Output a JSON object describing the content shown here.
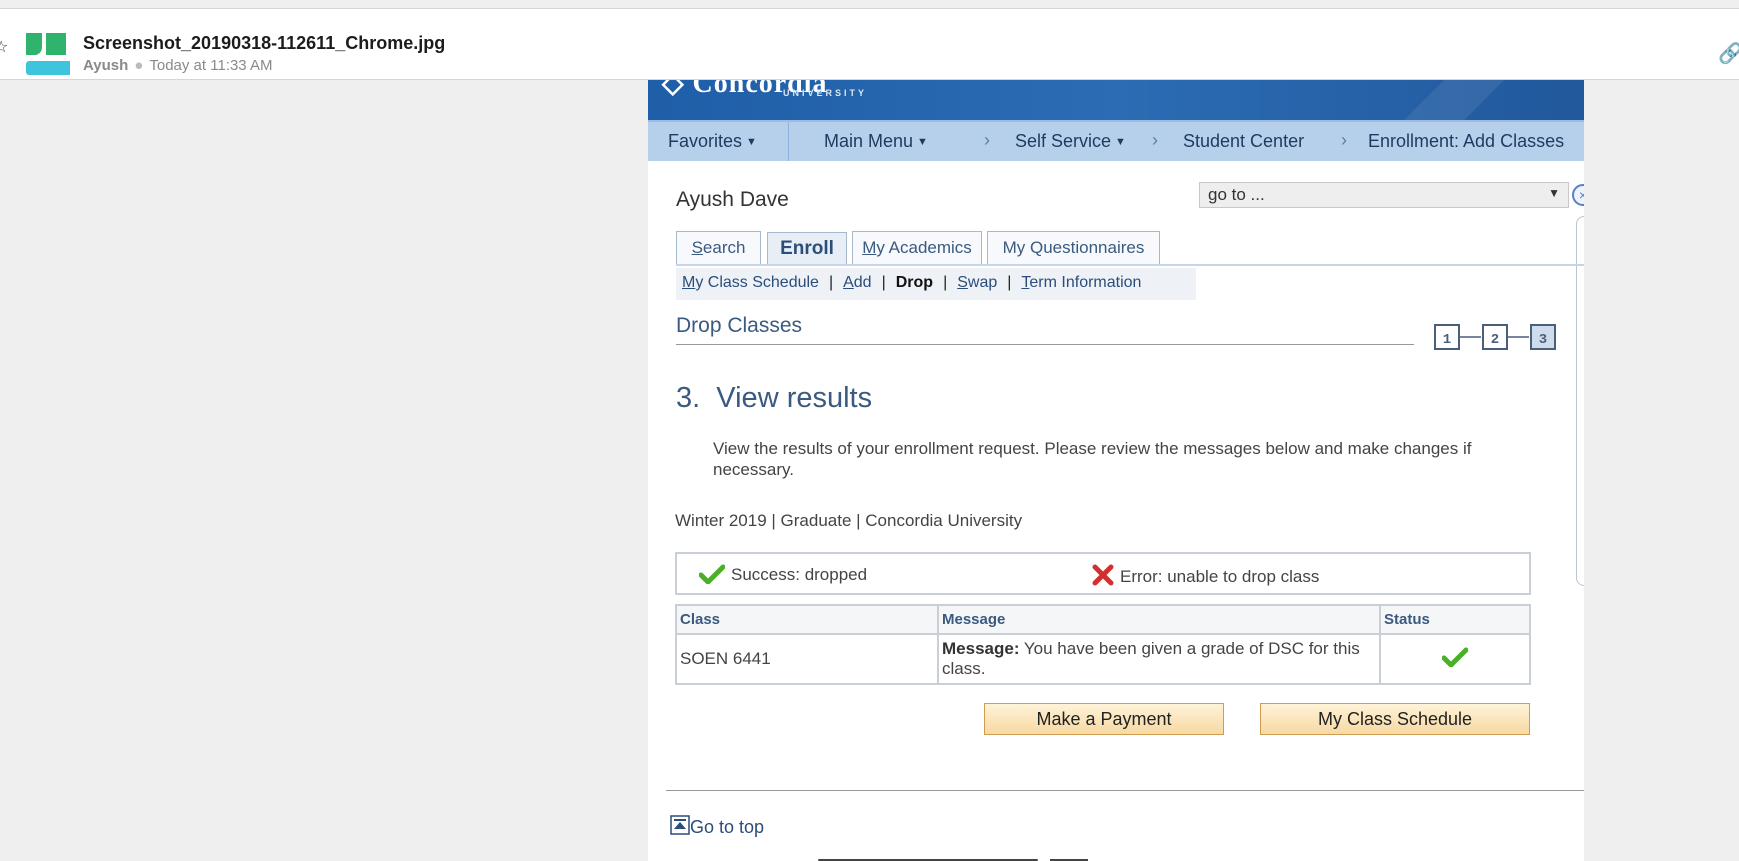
{
  "viewer": {
    "file_name": "Screenshot_20190318-112611_Chrome.jpg",
    "author": "Ayush",
    "timestamp": "Today at 11:33 AM"
  },
  "nav": {
    "favorites": "Favorites",
    "main_menu": "Main Menu",
    "self_service": "Self Service",
    "student_center": "Student Center",
    "enrollment_add": "Enrollment: Add Classes"
  },
  "student_name": "Ayush Dave",
  "goto": {
    "value": "go to ..."
  },
  "tabs": [
    {
      "pre": "",
      "u": "S",
      "post": "earch"
    },
    {
      "label": "Enroll"
    },
    {
      "pre": "",
      "u": "M",
      "post": "y Academics"
    },
    {
      "label": "My Questionnaires"
    }
  ],
  "subnav": {
    "schedule": {
      "u": "M",
      "post": "y Class Schedule"
    },
    "add": {
      "u": "A",
      "post": "dd"
    },
    "drop": "Drop",
    "swap": {
      "u": "S",
      "post": "wap"
    },
    "term": {
      "u": "T",
      "post": "erm Information"
    }
  },
  "section_title": "Drop Classes",
  "steps": [
    "1",
    "2",
    "3"
  ],
  "step_heading": "3.  View results",
  "step_desc": "View the results of your enrollment request.  Please review the messages below and make changes if necessary.",
  "term": "Winter 2019 | Graduate | Concordia University",
  "legend": {
    "success": "Success: dropped",
    "error": "Error: unable to drop class"
  },
  "table": {
    "headers": [
      "Class",
      "Message",
      "Status"
    ],
    "rows": [
      {
        "class": "SOEN 6441",
        "message_label": "Message:",
        "message": " You have been given a grade of DSC for this class.",
        "status": "success"
      }
    ]
  },
  "buttons": {
    "payment": "Make a Payment",
    "schedule": "My Class Schedule"
  },
  "go_to_top": "Go to top",
  "colors": {
    "banner": "#2b6cb4",
    "nav": "#b6d0ec",
    "link": "#2b4d79",
    "success": "#4caf28",
    "error": "#d32f2f"
  }
}
